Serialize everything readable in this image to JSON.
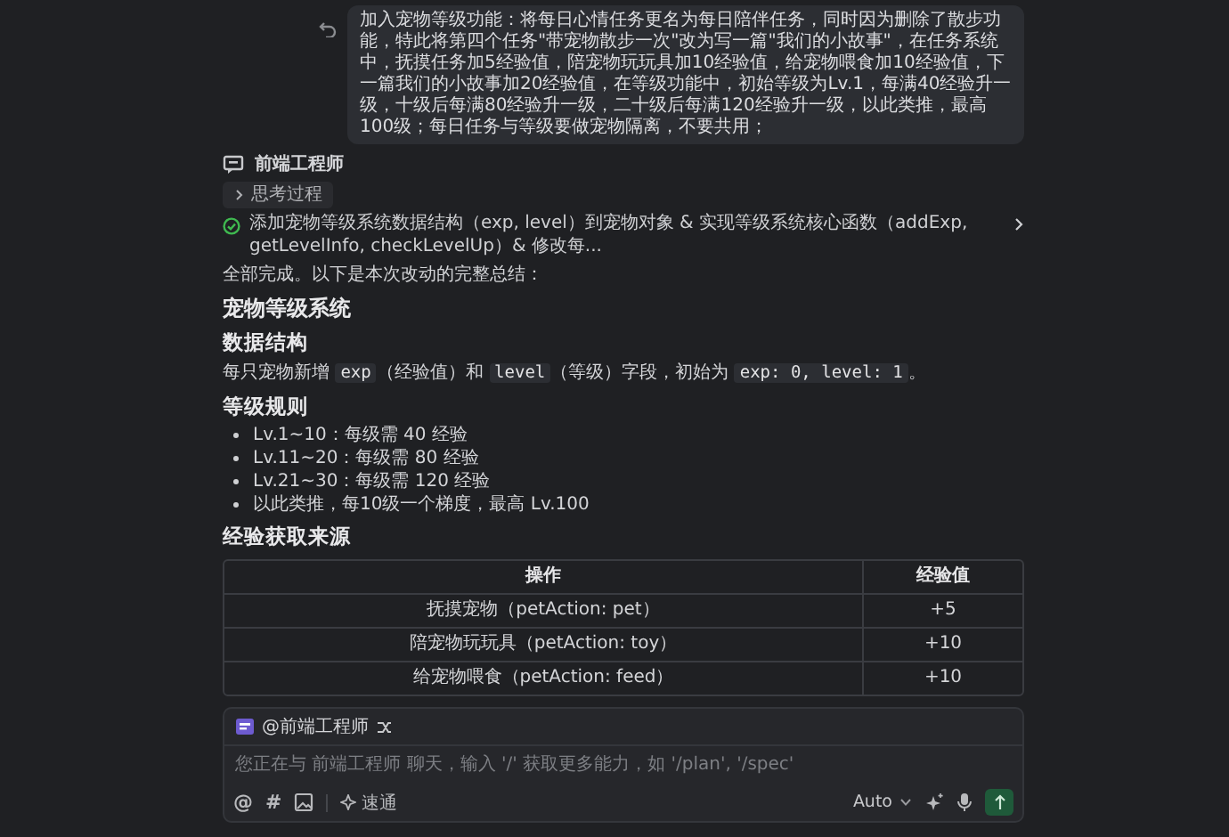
{
  "user_message": {
    "text": "加入宠物等级功能：将每日心情任务更名为每日陪伴任务，同时因为删除了散步功能，特此将第四个任务\"带宠物散步一次\"改为写一篇\"我们的小故事\"，在任务系统中，抚摸任务加5经验值，陪宠物玩玩具加10经验值，给宠物喂食加10经验值，下一篇我们的小故事加20经验值，在等级功能中，初始等级为Lv.1，每满40经验升一级，十级后每满80经验升一级，二十级后每满120经验升一级，以此类推，最高100级；每日任务与等级要做宠物隔离，不要共用；"
  },
  "agent": {
    "name": "前端工程师"
  },
  "thinking": {
    "label": "思考过程",
    "expanded": false
  },
  "task": {
    "text": "添加宠物等级系统数据结构（exp, level）到宠物对象 & 实现等级系统核心函数（addExp, getLevelInfo, checkLevelUp）& 修改每...",
    "done": true
  },
  "blocks": [
    {
      "kind": "para",
      "parts": [
        {
          "kind": "text",
          "text": "全部完成。以下是本次改动的完整总结："
        }
      ]
    },
    {
      "kind": "h1",
      "text": "宠物等级系统"
    },
    {
      "kind": "h2",
      "text": "数据结构"
    },
    {
      "kind": "para",
      "parts": [
        {
          "kind": "text",
          "text": "每只宠物新增 "
        },
        {
          "kind": "code",
          "text": "exp"
        },
        {
          "kind": "text",
          "text": "（经验值）和 "
        },
        {
          "kind": "code",
          "text": "level"
        },
        {
          "kind": "text",
          "text": "（等级）字段，初始为 "
        },
        {
          "kind": "code",
          "text": "exp: 0, level: 1"
        },
        {
          "kind": "text",
          "text": "。"
        }
      ]
    },
    {
      "kind": "h2",
      "text": "等级规则"
    },
    {
      "kind": "list",
      "items": [
        "Lv.1~10：每级需 40 经验",
        "Lv.11~20：每级需 80 经验",
        "Lv.21~30：每级需 120 经验",
        "以此类推，每10级一个梯度，最高 Lv.100"
      ]
    },
    {
      "kind": "h2",
      "text": "经验获取来源"
    },
    {
      "kind": "table",
      "columns": [
        "操作",
        "经验值"
      ],
      "rows": [
        [
          "抚摸宠物（petAction: pet）",
          "+5"
        ],
        [
          "陪宠物玩玩具（petAction: toy）",
          "+10"
        ],
        [
          "给宠物喂食（petAction: feed）",
          "+10"
        ]
      ]
    }
  ],
  "composer": {
    "tools": [
      "@",
      "#"
    ],
    "mention": "@前端工程师",
    "placeholder": "您正在与 前端工程师 聊天，输入 '/' 获取更多能力，如 '/plan', '/spec'",
    "mode_label": "速通",
    "model": "Auto"
  }
}
